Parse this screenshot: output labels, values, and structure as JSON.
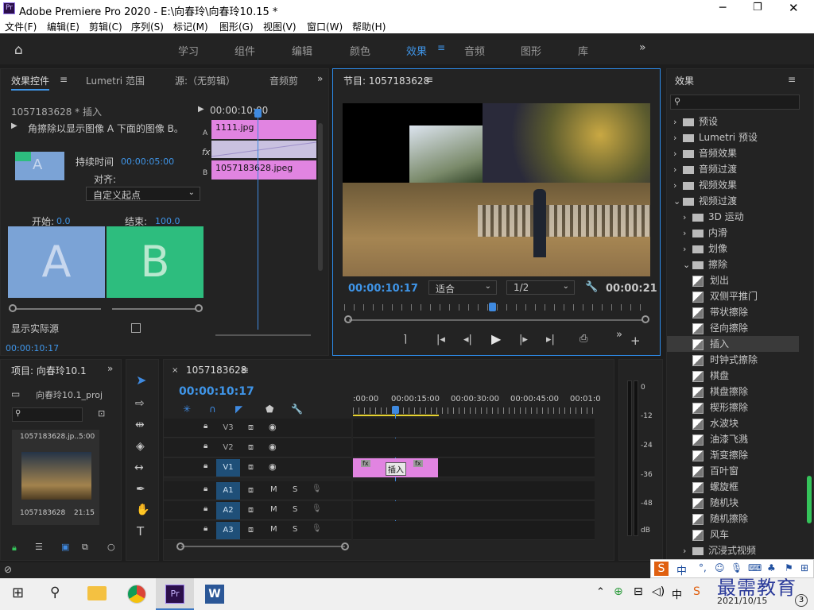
{
  "title": "Adobe Premiere Pro 2020 - E:\\向春玲\\向春玲10.15 *",
  "menu": [
    "文件(F)",
    "编辑(E)",
    "剪辑(C)",
    "序列(S)",
    "标记(M)",
    "图形(G)",
    "视图(V)",
    "窗口(W)",
    "帮助(H)"
  ],
  "workspaces": [
    "学习",
    "组件",
    "编辑",
    "颜色",
    "效果",
    "音频",
    "图形",
    "库"
  ],
  "effect_controls": {
    "tabs": [
      "效果控件",
      "Lumetri 范围",
      "源:（无剪辑）",
      "音频剪"
    ],
    "sequence": "1057183628 * 插入",
    "timecode_head": "00:00:10:00",
    "desc": "角擦除以显示图像 A 下面的图像 B。",
    "duration_label": "持续时间",
    "duration_value": "00:00:05:00",
    "align_label": "对齐:",
    "align_value": "自定义起点",
    "start_label": "开始:",
    "start_value": "0.0",
    "end_label": "结束:",
    "end_value": "100.0",
    "a_label": "A",
    "b_label": "B",
    "show_actual": "显示实际源",
    "clip1": "1111.jpg",
    "clip2": "1057183628.jpeg",
    "track_a": "A",
    "track_b": "B",
    "timecode_bottom": "00:00:10:17"
  },
  "program": {
    "title": "节目: 1057183628",
    "timecode": "00:00:10:17",
    "fit": "适合",
    "res": "1/2",
    "end_time": "00:00:21"
  },
  "effects": {
    "title": "效果",
    "items": [
      {
        "label": "预设",
        "level": 0,
        "type": "folder"
      },
      {
        "label": "Lumetri 预设",
        "level": 0,
        "type": "folder"
      },
      {
        "label": "音频效果",
        "level": 0,
        "type": "folder"
      },
      {
        "label": "音频过渡",
        "level": 0,
        "type": "folder"
      },
      {
        "label": "视频效果",
        "level": 0,
        "type": "folder"
      },
      {
        "label": "视频过渡",
        "level": 0,
        "type": "folder"
      },
      {
        "label": "3D 运动",
        "level": 1,
        "type": "folder"
      },
      {
        "label": "内滑",
        "level": 1,
        "type": "folder"
      },
      {
        "label": "划像",
        "level": 1,
        "type": "folder"
      },
      {
        "label": "擦除",
        "level": 1,
        "type": "folder"
      },
      {
        "label": "划出",
        "level": 2,
        "type": "fx"
      },
      {
        "label": "双侧平推门",
        "level": 2,
        "type": "fx"
      },
      {
        "label": "带状擦除",
        "level": 2,
        "type": "fx"
      },
      {
        "label": "径向擦除",
        "level": 2,
        "type": "fx"
      },
      {
        "label": "插入",
        "level": 2,
        "type": "fx"
      },
      {
        "label": "时钟式擦除",
        "level": 2,
        "type": "fx"
      },
      {
        "label": "棋盘",
        "level": 2,
        "type": "fx"
      },
      {
        "label": "棋盘擦除",
        "level": 2,
        "type": "fx"
      },
      {
        "label": "楔形擦除",
        "level": 2,
        "type": "fx"
      },
      {
        "label": "水波块",
        "level": 2,
        "type": "fx"
      },
      {
        "label": "油漆飞溅",
        "level": 2,
        "type": "fx"
      },
      {
        "label": "渐变擦除",
        "level": 2,
        "type": "fx"
      },
      {
        "label": "百叶窗",
        "level": 2,
        "type": "fx"
      },
      {
        "label": "螺旋框",
        "level": 2,
        "type": "fx"
      },
      {
        "label": "随机块",
        "level": 2,
        "type": "fx"
      },
      {
        "label": "随机擦除",
        "level": 2,
        "type": "fx"
      },
      {
        "label": "风车",
        "level": 2,
        "type": "fx"
      },
      {
        "label": "沉浸式视频",
        "level": 1,
        "type": "folder"
      }
    ]
  },
  "project": {
    "title": "项目: 向春玲10.1",
    "file": "向春玲10.1_proj",
    "thumb_name": "1057183628.jp...",
    "thumb_dur": "5:00",
    "thumb_name2": "1057183628",
    "thumb_dur2": "21:15"
  },
  "timeline": {
    "tab": "1057183628",
    "timecode": "00:00:10:17",
    "ruler": [
      ":00:00",
      "00:00:15:00",
      "00:00:30:00",
      "00:00:45:00",
      "00:01:0"
    ],
    "video_tracks": [
      "V3",
      "V2",
      "V1"
    ],
    "audio_tracks": [
      "A1",
      "A2",
      "A3"
    ],
    "transition": "插入",
    "m": "M",
    "s": "S",
    "fx": "fx"
  },
  "meter": [
    "0",
    "-12",
    "-24",
    "-36",
    "-48",
    "dB"
  ],
  "taskbar": {
    "ime": "中",
    "date": "2021/10/15",
    "badge": "3",
    "watermark": "最需教育"
  }
}
